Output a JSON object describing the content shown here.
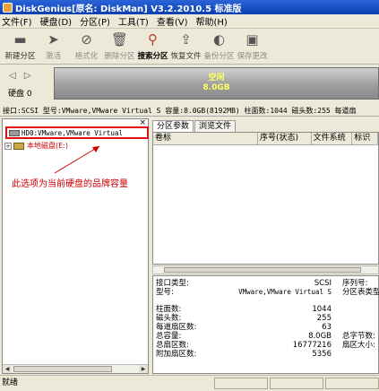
{
  "window": {
    "title": "DiskGenius[原名: DiskMan] V3.2.2010.5 标准版"
  },
  "menu": [
    "文件(F)",
    "硬盘(D)",
    "分区(P)",
    "工具(T)",
    "查看(V)",
    "帮助(H)"
  ],
  "toolbar": {
    "buttons": [
      {
        "label": "新建分区",
        "icon": "new-partition-icon",
        "glyph": "▬"
      },
      {
        "label": "激活",
        "icon": "activate-icon",
        "glyph": "➤"
      },
      {
        "label": "格式化",
        "icon": "format-icon",
        "glyph": "⊘"
      },
      {
        "label": "删除分区",
        "icon": "delete-partition-icon",
        "glyph": "🗑"
      },
      {
        "label": "搜索分区",
        "icon": "search-partition-icon",
        "glyph": "⚲"
      },
      {
        "label": "恢复文件",
        "icon": "recover-files-icon",
        "glyph": "⇪"
      },
      {
        "label": "备份分区",
        "icon": "backup-partition-icon",
        "glyph": "◐"
      },
      {
        "label": "保存更改",
        "icon": "save-changes-icon",
        "glyph": "▣"
      }
    ]
  },
  "diskbar": {
    "arrows": "◁ ▷",
    "disk_label": "硬盘 0",
    "bar_title": "空闲",
    "bar_size": "8.0GB",
    "bar_color": "#9e9e9e",
    "text_color": "#ffff66"
  },
  "infoline": "接口:SCSI  型号:VMware,VMware Virtual S  容量:8.0GB(8192MB)  柱面数:1044  磁头数:255  每道扇",
  "tree": {
    "hdd_item": "HD0:VMware,VMware Virtual",
    "local_item": "本地磁盘(E:)",
    "annotation": "此选项为当前硬盘的品牌容量",
    "annotation_color": "#cc0000"
  },
  "tabs": [
    {
      "label": "分区参数",
      "active": true
    },
    {
      "label": "浏览文件",
      "active": false
    }
  ],
  "grid": {
    "columns": [
      "卷标",
      "序号(状态)",
      "文件系统",
      "标识"
    ]
  },
  "details": {
    "interface_label": "接口类型:",
    "interface_value": "SCSI",
    "serial_label": "序列号:",
    "model_label": "型号:",
    "model_value": "VMware,VMware Virtual S",
    "partition_table_label": "分区表类型:",
    "cylinders_label": "柱面数:",
    "cylinders_value": "1044",
    "heads_label": "磁头数:",
    "heads_value": "255",
    "sectors_per_track_label": "每道扇区数:",
    "sectors_per_track_value": "63",
    "capacity_label": "总容量:",
    "capacity_value": "8.0GB",
    "total_bytes_label": "总字节数:",
    "total_sectors_label": "总扇区数:",
    "total_sectors_value": "16777216",
    "sector_size_label": "扇区大小:",
    "extra_sectors_label": "附加扇区数:",
    "extra_sectors_value": "5356"
  },
  "status": {
    "text": "就绪"
  }
}
